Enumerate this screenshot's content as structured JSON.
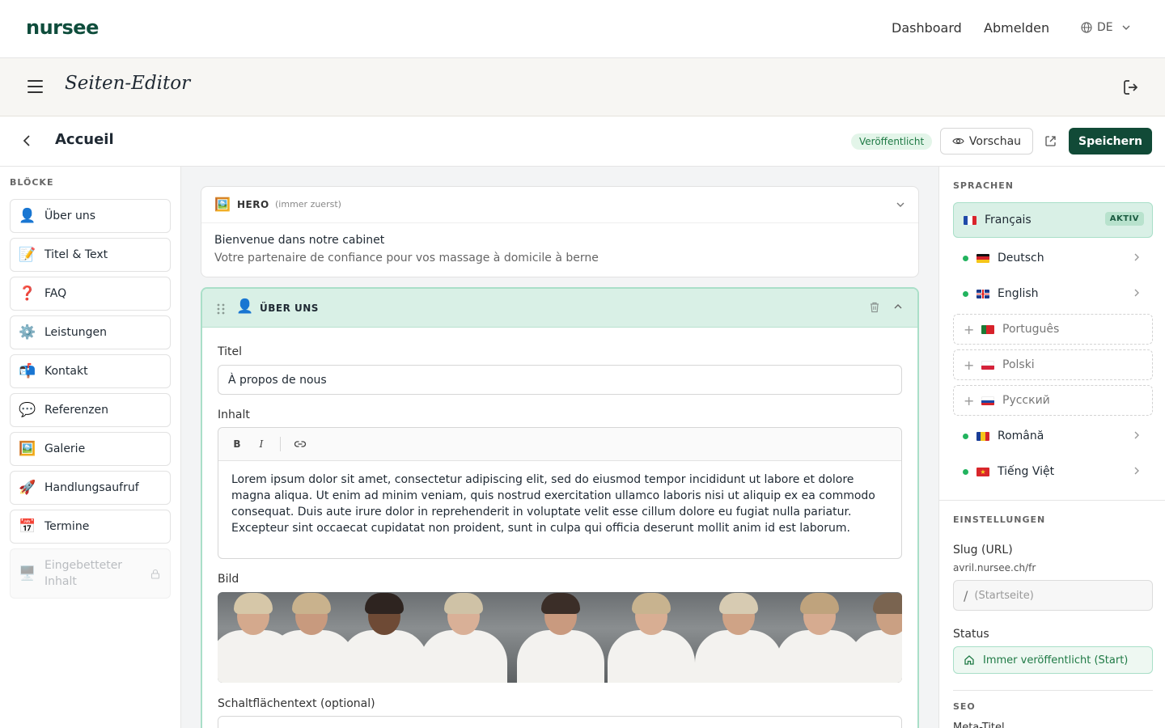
{
  "topnav": {
    "logo": "nursee",
    "links": [
      "Dashboard",
      "Abmelden"
    ],
    "language": "DE"
  },
  "editor": {
    "title": "Seiten-Editor"
  },
  "page": {
    "title": "Accueil",
    "status_badge": "Veröffentlicht",
    "preview_label": "Vorschau",
    "save_label": "Speichern"
  },
  "blocks": {
    "heading": "BLÖCKE",
    "items": [
      {
        "icon": "👤",
        "label": "Über uns"
      },
      {
        "icon": "📝",
        "label": "Titel & Text"
      },
      {
        "icon": "❓",
        "label": "FAQ"
      },
      {
        "icon": "⚙️",
        "label": "Leistungen"
      },
      {
        "icon": "📬",
        "label": "Kontakt"
      },
      {
        "icon": "💬",
        "label": "Referenzen"
      },
      {
        "icon": "🖼️",
        "label": "Galerie"
      },
      {
        "icon": "🚀",
        "label": "Handlungsaufruf"
      },
      {
        "icon": "📅",
        "label": "Termine"
      }
    ],
    "disabled_item": {
      "icon": "🖥️",
      "label": "Eingebetteter Inhalt"
    }
  },
  "hero": {
    "icon": "🖼️",
    "label": "HERO",
    "note": "(immer zuerst)",
    "title": "Bienvenue dans notre cabinet",
    "subtitle": "Votre partenaire de confiance pour vos massage à domicile à berne"
  },
  "about": {
    "icon": "👤",
    "label": "ÜBER UNS",
    "title_label": "Titel",
    "title_value": "À propos de nous",
    "content_label": "Inhalt",
    "toolbar": {
      "bold": "B",
      "italic": "I"
    },
    "content": "Lorem ipsum dolor sit amet, consectetur adipiscing elit, sed do eiusmod tempor incididunt ut labore et dolore magna aliqua. Ut enim ad minim veniam, quis nostrud exercitation ullamco laboris nisi ut aliquip ex ea commodo consequat. Duis aute irure dolor in reprehenderit in voluptate velit esse cillum dolore eu fugiat nulla pariatur. Excepteur sint occaecat cupidatat non proident, sunt in culpa qui officia deserunt mollit anim id est laborum.",
    "image_label": "Bild",
    "button_label": "Schaltflächentext (optional)"
  },
  "languages": {
    "heading": "SPRACHEN",
    "active": {
      "name": "Français",
      "badge": "AKTIV"
    },
    "items": [
      {
        "name": "Deutsch",
        "state": "done"
      },
      {
        "name": "English",
        "state": "done"
      },
      {
        "name": "Português",
        "state": "missing"
      },
      {
        "name": "Polski",
        "state": "missing"
      },
      {
        "name": "Русский",
        "state": "missing"
      },
      {
        "name": "Română",
        "state": "done"
      },
      {
        "name": "Tiếng Việt",
        "state": "done"
      }
    ]
  },
  "settings": {
    "heading": "EINSTELLUNGEN",
    "slug_label": "Slug (URL)",
    "slug_base": "avril.nursee.ch/fr",
    "slug_slash": "/",
    "slug_placeholder": "(Startseite)",
    "status_label": "Status",
    "status_value": "Immer veröffentlicht (Start)"
  },
  "seo": {
    "heading": "SEO",
    "meta_title_label": "Meta-Titel"
  },
  "colors": {
    "brand": "#114a37",
    "accent_bg": "#d9f0e6",
    "success": "#22b35e"
  }
}
